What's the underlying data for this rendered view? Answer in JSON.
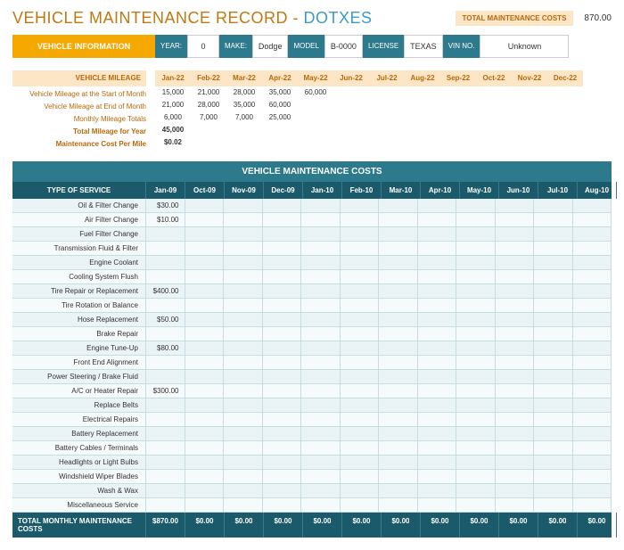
{
  "header": {
    "title_prefix": "VEHICLE MAINTENANCE RECORD - ",
    "brand": "DOTXES",
    "total_label": "TOTAL MAINTENANCE COSTS",
    "total_value": "870.00"
  },
  "info": {
    "section_label": "VEHICLE INFORMATION",
    "fields": [
      {
        "label": "YEAR:",
        "value": "0"
      },
      {
        "label": "MAKE:",
        "value": "Dodge"
      },
      {
        "label": "MODEL",
        "value": "B-0000"
      },
      {
        "label": "LICENSE",
        "value": "TEXAS"
      },
      {
        "label": "VIN NO.",
        "value": "Unknown",
        "wide": true
      }
    ]
  },
  "mileage": {
    "header_label": "VEHICLE MILEAGE",
    "months": [
      "Jan-22",
      "Feb-22",
      "Mar-22",
      "Apr-22",
      "May-22",
      "Jun-22",
      "Jul-22",
      "Aug-22",
      "Sep-22",
      "Oct-22",
      "Nov-22",
      "Dec-22"
    ],
    "rows": [
      {
        "label": "Vehicle Mileage at the Start of Month",
        "values": [
          "15,000",
          "21,000",
          "28,000",
          "35,000",
          "60,000",
          "",
          "",
          "",
          "",
          "",
          "",
          ""
        ],
        "bold": false
      },
      {
        "label": "Vehicle Mileage at End of Month",
        "values": [
          "21,000",
          "28,000",
          "35,000",
          "60,000",
          "",
          "",
          "",
          "",
          "",
          "",
          "",
          ""
        ],
        "bold": false
      },
      {
        "label": "Monthly Mileage Totals",
        "values": [
          "6,000",
          "7,000",
          "7,000",
          "25,000",
          "",
          "",
          "",
          "",
          "",
          "",
          "",
          ""
        ],
        "bold": false
      },
      {
        "label": "Total Mileage for Year",
        "values": [
          "45,000",
          "",
          "",
          "",
          "",
          "",
          "",
          "",
          "",
          "",
          "",
          ""
        ],
        "bold": true
      },
      {
        "label": "Maintenance Cost Per Mile",
        "values": [
          "$0.02",
          "",
          "",
          "",
          "",
          "",
          "",
          "",
          "",
          "",
          "",
          ""
        ],
        "bold": true
      }
    ]
  },
  "costs": {
    "title": "VEHICLE MAINTENANCE COSTS",
    "type_header": "TYPE OF SERVICE",
    "months": [
      "Jan-09",
      "Oct-09",
      "Nov-09",
      "Dec-09",
      "Jan-10",
      "Feb-10",
      "Mar-10",
      "Apr-10",
      "May-10",
      "Jun-10",
      "Jul-10",
      "Aug-10"
    ],
    "services": [
      {
        "name": "Oil & Filter Change",
        "values": [
          "$30.00",
          "",
          "",
          "",
          "",
          "",
          "",
          "",
          "",
          "",
          "",
          ""
        ]
      },
      {
        "name": "Air Filter Change",
        "values": [
          "$10.00",
          "",
          "",
          "",
          "",
          "",
          "",
          "",
          "",
          "",
          "",
          ""
        ]
      },
      {
        "name": "Fuel Filter Change",
        "values": [
          "",
          "",
          "",
          "",
          "",
          "",
          "",
          "",
          "",
          "",
          "",
          ""
        ]
      },
      {
        "name": "Transmission Fluid & Filter",
        "values": [
          "",
          "",
          "",
          "",
          "",
          "",
          "",
          "",
          "",
          "",
          "",
          ""
        ]
      },
      {
        "name": "Engine Coolant",
        "values": [
          "",
          "",
          "",
          "",
          "",
          "",
          "",
          "",
          "",
          "",
          "",
          ""
        ]
      },
      {
        "name": "Cooling System Flush",
        "values": [
          "",
          "",
          "",
          "",
          "",
          "",
          "",
          "",
          "",
          "",
          "",
          ""
        ]
      },
      {
        "name": "Tire Repair or Replacement",
        "values": [
          "$400.00",
          "",
          "",
          "",
          "",
          "",
          "",
          "",
          "",
          "",
          "",
          ""
        ]
      },
      {
        "name": "Tire Rotation or Balance",
        "values": [
          "",
          "",
          "",
          "",
          "",
          "",
          "",
          "",
          "",
          "",
          "",
          ""
        ]
      },
      {
        "name": "Hose Replacement",
        "values": [
          "$50.00",
          "",
          "",
          "",
          "",
          "",
          "",
          "",
          "",
          "",
          "",
          ""
        ]
      },
      {
        "name": "Brake Repair",
        "values": [
          "",
          "",
          "",
          "",
          "",
          "",
          "",
          "",
          "",
          "",
          "",
          ""
        ]
      },
      {
        "name": "Engine Tune-Up",
        "values": [
          "$80.00",
          "",
          "",
          "",
          "",
          "",
          "",
          "",
          "",
          "",
          "",
          ""
        ]
      },
      {
        "name": "Front End Alignment",
        "values": [
          "",
          "",
          "",
          "",
          "",
          "",
          "",
          "",
          "",
          "",
          "",
          ""
        ]
      },
      {
        "name": "Power Steering / Brake Fluid",
        "values": [
          "",
          "",
          "",
          "",
          "",
          "",
          "",
          "",
          "",
          "",
          "",
          ""
        ]
      },
      {
        "name": "A/C or Heater Repair",
        "values": [
          "$300.00",
          "",
          "",
          "",
          "",
          "",
          "",
          "",
          "",
          "",
          "",
          ""
        ]
      },
      {
        "name": "Replace Belts",
        "values": [
          "",
          "",
          "",
          "",
          "",
          "",
          "",
          "",
          "",
          "",
          "",
          ""
        ]
      },
      {
        "name": "Electrical Repairs",
        "values": [
          "",
          "",
          "",
          "",
          "",
          "",
          "",
          "",
          "",
          "",
          "",
          ""
        ]
      },
      {
        "name": "Battery Replacement",
        "values": [
          "",
          "",
          "",
          "",
          "",
          "",
          "",
          "",
          "",
          "",
          "",
          ""
        ]
      },
      {
        "name": "Battery Cables / Terminals",
        "values": [
          "",
          "",
          "",
          "",
          "",
          "",
          "",
          "",
          "",
          "",
          "",
          ""
        ]
      },
      {
        "name": "Headlights or Light Bulbs",
        "values": [
          "",
          "",
          "",
          "",
          "",
          "",
          "",
          "",
          "",
          "",
          "",
          ""
        ]
      },
      {
        "name": "Windshield Wiper Blades",
        "values": [
          "",
          "",
          "",
          "",
          "",
          "",
          "",
          "",
          "",
          "",
          "",
          ""
        ]
      },
      {
        "name": "Wash & Wax",
        "values": [
          "",
          "",
          "",
          "",
          "",
          "",
          "",
          "",
          "",
          "",
          "",
          ""
        ]
      },
      {
        "name": "Miscellaneous Service",
        "values": [
          "",
          "",
          "",
          "",
          "",
          "",
          "",
          "",
          "",
          "",
          "",
          ""
        ]
      }
    ],
    "footer_label": "TOTAL MONTHLY MAINTENANCE COSTS",
    "footer_values": [
      "$870.00",
      "$0.00",
      "$0.00",
      "$0.00",
      "$0.00",
      "$0.00",
      "$0.00",
      "$0.00",
      "$0.00",
      "$0.00",
      "$0.00",
      "$0.00"
    ]
  }
}
